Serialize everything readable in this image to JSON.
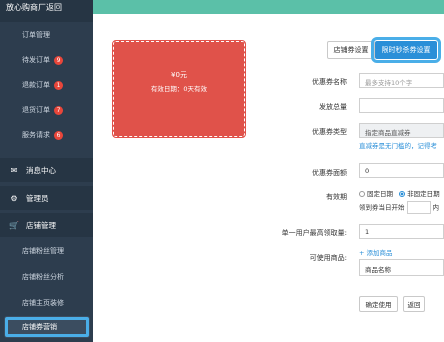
{
  "sidebar": {
    "brand": "放心购商厂返回",
    "sub_items_top": [
      {
        "label": "订单管理"
      },
      {
        "label": "待发订单",
        "badge": "9"
      },
      {
        "label": "退款订单",
        "badge": "1"
      },
      {
        "label": "退货订单",
        "badge": "7"
      },
      {
        "label": "服务请求",
        "badge": "6"
      }
    ],
    "groups": [
      {
        "label": "消息中心",
        "icon": "envelope-icon"
      },
      {
        "label": "管理员",
        "icon": "gears-icon"
      },
      {
        "label": "店铺管理",
        "icon": "cart-icon"
      }
    ],
    "store_items": [
      {
        "label": "店铺粉丝管理"
      },
      {
        "label": "店铺粉丝分析"
      },
      {
        "label": "店铺主页装修"
      },
      {
        "label": "店铺券营销"
      }
    ]
  },
  "tabs": {
    "store_coupon": "店铺券设置",
    "flash_coupon": "限时秒杀券设置"
  },
  "coupon_preview": {
    "amount": "¥0元",
    "validity": "有效日期：0天有效"
  },
  "form": {
    "name_label": "优惠券名称",
    "name_placeholder": "最多支持10个字",
    "total_label": "发放总量",
    "type_label": "优惠券类型",
    "type_value": "指定商品直减券",
    "type_hint": "直减券是无门槛的，记得考",
    "amount_label": "优惠券面额",
    "amount_value": "0",
    "validity_label": "有效期",
    "validity_opt_fixed": "固定日期",
    "validity_opt_rolling": "非固定日期",
    "validity_rolling_text_pre": "领到券当日开始",
    "validity_rolling_text_post": "内",
    "limit_label": "单一用户最高领取量:",
    "limit_value": "1",
    "goods_label": "可使用商品:",
    "add_goods": "+ 添加商品",
    "goods_col": "商品名称",
    "confirm": "确定使用",
    "back": "返回"
  },
  "colors": {
    "sidebar": "#2d3d4e",
    "topbar": "#5bc0a8",
    "coupon": "#e0524a",
    "accent": "#2a8fd8",
    "badge": "#e8463a"
  }
}
